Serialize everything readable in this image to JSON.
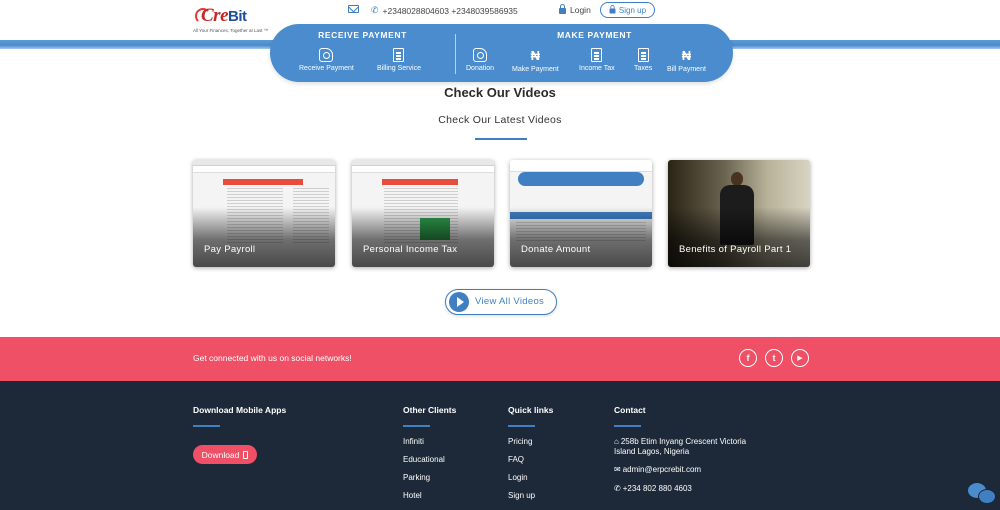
{
  "header": {
    "logo_text_cre": "Cre",
    "logo_text_bit": "Bit",
    "logo_tagline": "All Your Finances, Together at Last ™",
    "phones": "+2348028804603 +2348039586935",
    "login_label": "Login",
    "signup_label": "Sign up"
  },
  "pay_menu": {
    "receive_heading": "RECEIVE PAYMENT",
    "make_heading": "MAKE PAYMENT",
    "receive_items": [
      {
        "label": "Receive Payment",
        "icon": "hand-coin-icon"
      },
      {
        "label": "Billing Service",
        "icon": "invoice-icon"
      }
    ],
    "make_items": [
      {
        "label": "Donation",
        "icon": "hand-coin-icon"
      },
      {
        "label": "Make Payment",
        "icon": "naira-icon"
      },
      {
        "label": "Income Tax",
        "icon": "invoice-icon"
      },
      {
        "label": "Taxes",
        "icon": "invoice-icon"
      },
      {
        "label": "Bill Payment",
        "icon": "naira-icon"
      }
    ],
    "naira_symbol": "₦"
  },
  "videos": {
    "title": "Check Our Videos",
    "subtitle": "Check Our Latest Videos",
    "cards": [
      {
        "title": "Pay Payroll"
      },
      {
        "title": "Personal Income Tax"
      },
      {
        "title": "Donate Amount"
      },
      {
        "title": "Benefits of Payroll Part 1"
      }
    ],
    "view_all_label": "View All Videos"
  },
  "social": {
    "text": "Get connected with us on social networks!",
    "icons": [
      {
        "name": "facebook-icon",
        "glyph": "f"
      },
      {
        "name": "twitter-icon",
        "glyph": "t"
      },
      {
        "name": "youtube-icon",
        "glyph": "▶"
      }
    ]
  },
  "footer": {
    "mobile": {
      "heading": "Download Mobile Apps",
      "button": "Download"
    },
    "clients": {
      "heading": "Other Clients",
      "links": [
        "Infiniti",
        "Educational",
        "Parking",
        "Hotel"
      ]
    },
    "quick": {
      "heading": "Quick links",
      "links": [
        "Pricing",
        "FAQ",
        "Login",
        "Sign up"
      ]
    },
    "contact": {
      "heading": "Contact",
      "address_line1": "258b Etim Inyang Crescent Victoria",
      "address_line2": "Island Lagos, Nigeria",
      "email": "admin@erpcrebit.com",
      "phone": "+234 802 880 4603"
    }
  },
  "colors": {
    "primary": "#4a8ccd",
    "accent": "#ef5066",
    "footer_bg": "#1d2838"
  }
}
